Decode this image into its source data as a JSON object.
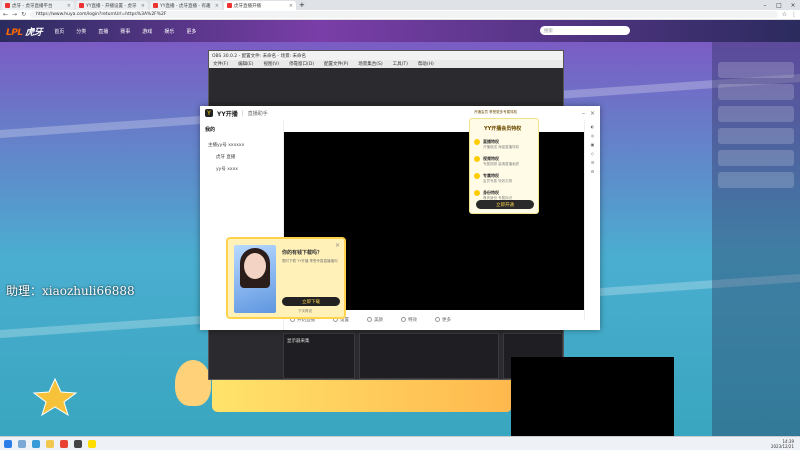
{
  "browser": {
    "tabs": [
      {
        "title": "虎牙 - 虎牙直播平台"
      },
      {
        "title": "YY直播 - 开播设置 - 虎牙"
      },
      {
        "title": "YY直播 - 虎牙直播 - 有趣"
      },
      {
        "title": "虎牙直播开播"
      }
    ],
    "url": "https://www.huya.com/login?returnUrl=https%3A%2F%2F"
  },
  "huya": {
    "logo_a": "虎牙",
    "logo_b": "LPL",
    "nav": [
      "首页",
      "分类",
      "直播",
      "赛事",
      "游戏",
      "娱乐",
      "更多"
    ],
    "search_placeholder": "搜索",
    "assistant_text": "助理：xiaozhuli66888"
  },
  "obs": {
    "title": "OBS 30.0.2 - 配置文件: 未命名 - 场景: 未命名",
    "menu": [
      "文件(F)",
      "编辑(E)",
      "视图(V)",
      "停靠窗口(D)",
      "配置文件(P)",
      "场景集合(S)",
      "工具(T)",
      "帮助(H)"
    ],
    "source_label": "显示器采集"
  },
  "yy": {
    "app_name": "YY开播",
    "divider": "|",
    "sub": "直播助手",
    "side_header": "我的",
    "side_items": [
      "主播yy号 xxxxxx",
      "虎牙 直播",
      "yy号 xxxx"
    ],
    "bottom_items": [
      "开始直播",
      "设置",
      "美颜",
      "特效",
      "更多"
    ]
  },
  "vip": {
    "top_label": "开通会员 享受更多专属特权",
    "title": "YY开播会员特权",
    "items": [
      {
        "name": "直播特权",
        "desc": "开播就送 海量直播特权"
      },
      {
        "name": "视频特权",
        "desc": "专属视频 高清直播画质"
      },
      {
        "name": "专属特权",
        "desc": "会员专属 特效礼物"
      },
      {
        "name": "身份特权",
        "desc": "尊贵身份 专属标识"
      }
    ],
    "button": "立即开通"
  },
  "download": {
    "title": "你的有钱下载吗？",
    "desc": "限时下载 YY开播 享受专属直播福利",
    "button": "立即下载",
    "link": "下次再说"
  },
  "taskbar": {
    "time": "14:39",
    "date": "2023/12/21"
  }
}
